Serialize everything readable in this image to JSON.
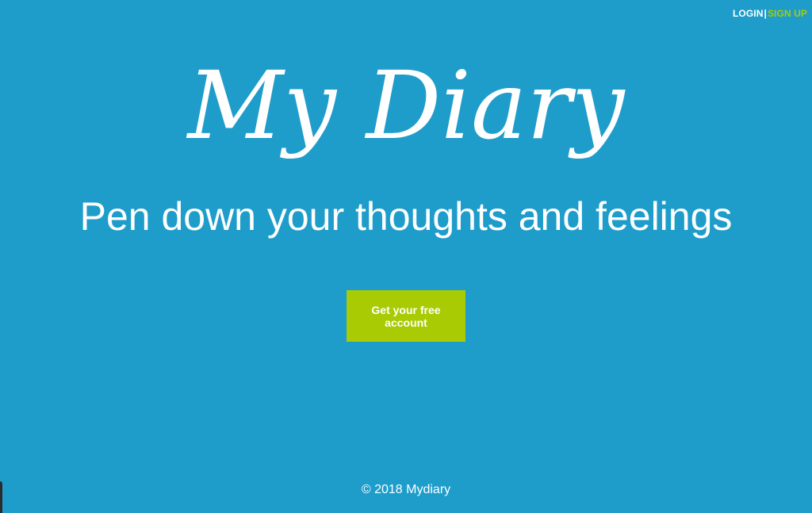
{
  "nav": {
    "login_label": "LOGIN",
    "separator": "|",
    "signup_label": "SIGN UP"
  },
  "hero": {
    "title": "My Diary",
    "tagline": "Pen down your thoughts and feelings",
    "cta_label": "Get your free account"
  },
  "footer": {
    "copyright": "© 2018 Mydiary"
  },
  "colors": {
    "background": "#1e9dcb",
    "accent": "#a9cb04",
    "text": "#ffffff"
  }
}
